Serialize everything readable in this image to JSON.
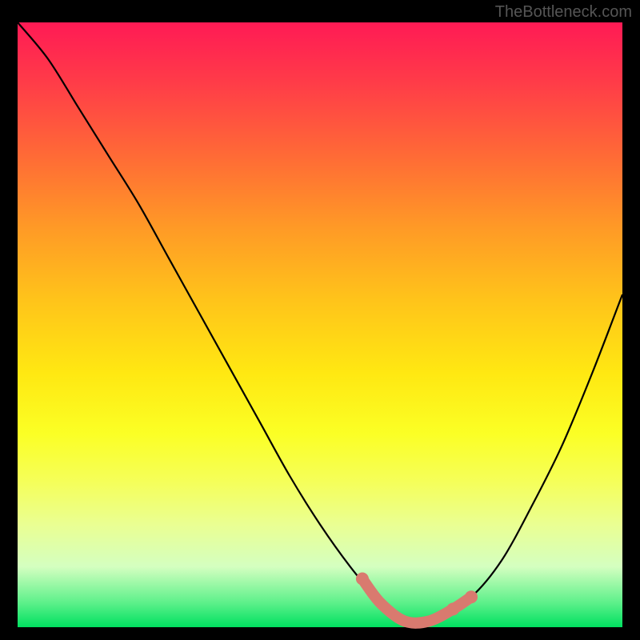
{
  "watermark": "TheBottleneck.com",
  "chart_data": {
    "type": "line",
    "title": "",
    "xlabel": "",
    "ylabel": "",
    "xlim": [
      0,
      100
    ],
    "ylim": [
      0,
      100
    ],
    "series": [
      {
        "name": "bottleneck-curve",
        "x": [
          0,
          5,
          10,
          15,
          20,
          25,
          30,
          35,
          40,
          45,
          50,
          55,
          60,
          62,
          64,
          66,
          70,
          75,
          80,
          85,
          90,
          95,
          100
        ],
        "y": [
          100,
          94,
          86,
          78,
          70,
          61,
          52,
          43,
          34,
          25,
          17,
          10,
          4,
          2,
          1,
          1,
          2,
          5,
          11,
          20,
          30,
          42,
          55
        ]
      }
    ],
    "highlight_region": {
      "name": "optimal-range",
      "x": [
        57,
        60,
        64,
        68,
        72,
        75
      ],
      "y": [
        8,
        4,
        1,
        1,
        3,
        5
      ]
    },
    "marker_points": {
      "name": "optimal-markers",
      "x": [
        57,
        72,
        75
      ],
      "y": [
        8,
        3,
        5
      ]
    },
    "background_gradient": {
      "top_color": "#ff1a55",
      "bottom_color": "#00e060",
      "description": "red-to-green vertical gradient (bottleneck severity)"
    }
  }
}
